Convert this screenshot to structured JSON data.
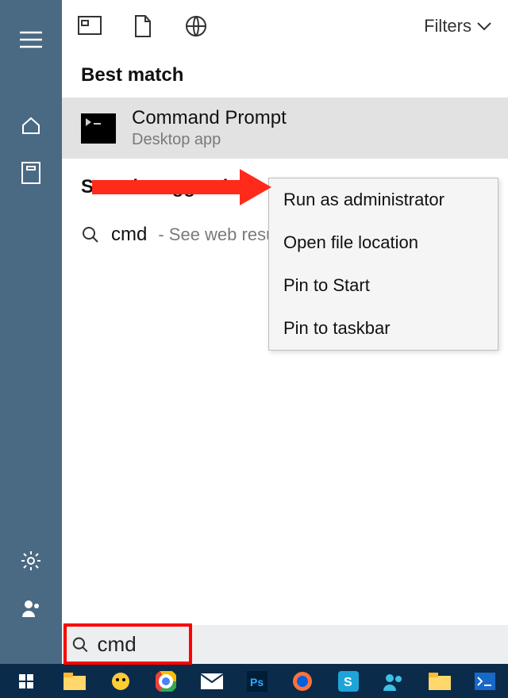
{
  "sidebar": {
    "icons": [
      "menu",
      "home",
      "apps",
      "settings",
      "account"
    ]
  },
  "topbar": {
    "filters_label": "Filters"
  },
  "sections": {
    "best_match": "Best match",
    "suggestions": "Search suggestions"
  },
  "result": {
    "title": "Command Prompt",
    "subtitle": "Desktop app"
  },
  "suggestion": {
    "term": "cmd",
    "hint": "- See web results"
  },
  "context_menu": {
    "items": [
      "Run as administrator",
      "Open file location",
      "Pin to Start",
      "Pin to taskbar"
    ]
  },
  "search": {
    "placeholder": "",
    "value": "cmd"
  },
  "taskbar": {
    "items": [
      "start",
      "explorer",
      "lego",
      "chrome",
      "mail",
      "photoshop",
      "firefox",
      "snagit",
      "contacts",
      "files",
      "terminal"
    ]
  }
}
